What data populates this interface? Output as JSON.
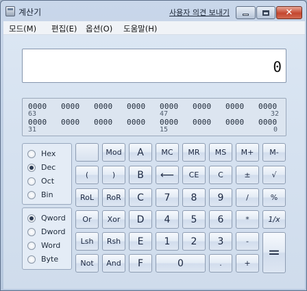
{
  "window": {
    "title": "계산기",
    "feedback_link": "사용자 의견 보내기"
  },
  "menu": [
    "모드(M)",
    "편집(E)",
    "옵션(O)",
    "도움말(H)"
  ],
  "display": {
    "value": "0"
  },
  "bits": {
    "row1": [
      "0000",
      "0000",
      "0000",
      "0000",
      "0000",
      "0000",
      "0000",
      "0000"
    ],
    "row1_positions": [
      "63",
      "47",
      "32"
    ],
    "row2": [
      "0000",
      "0000",
      "0000",
      "0000",
      "0000",
      "0000",
      "0000",
      "0000"
    ],
    "row2_positions": [
      "31",
      "15",
      "0"
    ]
  },
  "base_group": {
    "options": [
      "Hex",
      "Dec",
      "Oct",
      "Bin"
    ],
    "selected": "Dec"
  },
  "word_group": {
    "options": [
      "Qword",
      "Dword",
      "Word",
      "Byte"
    ],
    "selected": "Qword"
  },
  "keys": {
    "mod": "Mod",
    "A": "A",
    "MC": "MC",
    "MR": "MR",
    "MS": "MS",
    "Mplus": "M+",
    "Mminus": "M-",
    "lparen": "(",
    "rparen": ")",
    "B": "B",
    "backspace": "⟵",
    "CE": "CE",
    "C": "C",
    "plusminus": "±",
    "sqrt": "√",
    "RoL": "RoL",
    "RoR": "RoR",
    "Ckey": "C",
    "n7": "7",
    "n8": "8",
    "n9": "9",
    "divide": "/",
    "percent": "%",
    "Or": "Or",
    "Xor": "Xor",
    "D": "D",
    "n4": "4",
    "n5": "5",
    "n6": "6",
    "multiply": "*",
    "reciprocal": "1/x",
    "Lsh": "Lsh",
    "Rsh": "Rsh",
    "E": "E",
    "n1": "1",
    "n2": "2",
    "n3": "3",
    "minus": "-",
    "equals": "=",
    "Not": "Not",
    "And": "And",
    "F": "F",
    "n0": "0",
    "dot": ".",
    "plus": "+"
  }
}
